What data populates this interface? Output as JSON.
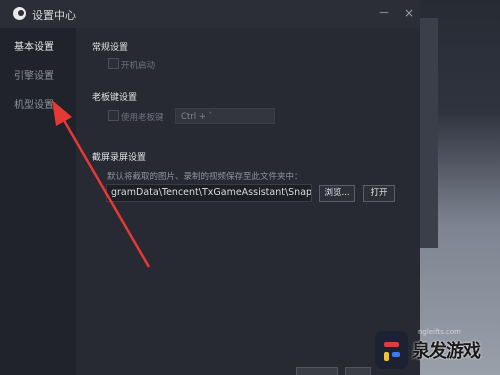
{
  "window": {
    "title": "设置中心",
    "minimize_label": "－",
    "close_label": "×"
  },
  "sidebar": {
    "items": [
      {
        "label": "基本设置",
        "active": true
      },
      {
        "label": "引擎设置",
        "active": false
      },
      {
        "label": "机型设置",
        "active": false
      }
    ]
  },
  "general": {
    "heading": "常规设置",
    "startup_label": "开机启动",
    "startup_checked": false
  },
  "boss_key": {
    "heading": "老板键设置",
    "enable_label": "使用老板键",
    "enable_checked": false,
    "hotkey_value": "Ctrl + `"
  },
  "screenshot": {
    "heading": "截屏录屏设置",
    "description": "默认将截取的图片、录制的视频保存至此文件夹中：",
    "path_value": "gramData\\Tencent\\TxGameAssistant\\Snapshot",
    "browse_label": "浏览...",
    "open_label": "打开"
  },
  "watermark": {
    "text": "泉发游戏",
    "sub": "ngleifts.com"
  },
  "colors": {
    "dialog_bg": "#272a33",
    "sidebar_bg": "#20232b",
    "arrow": "#e53935",
    "active_text": "#e6e8ec"
  }
}
